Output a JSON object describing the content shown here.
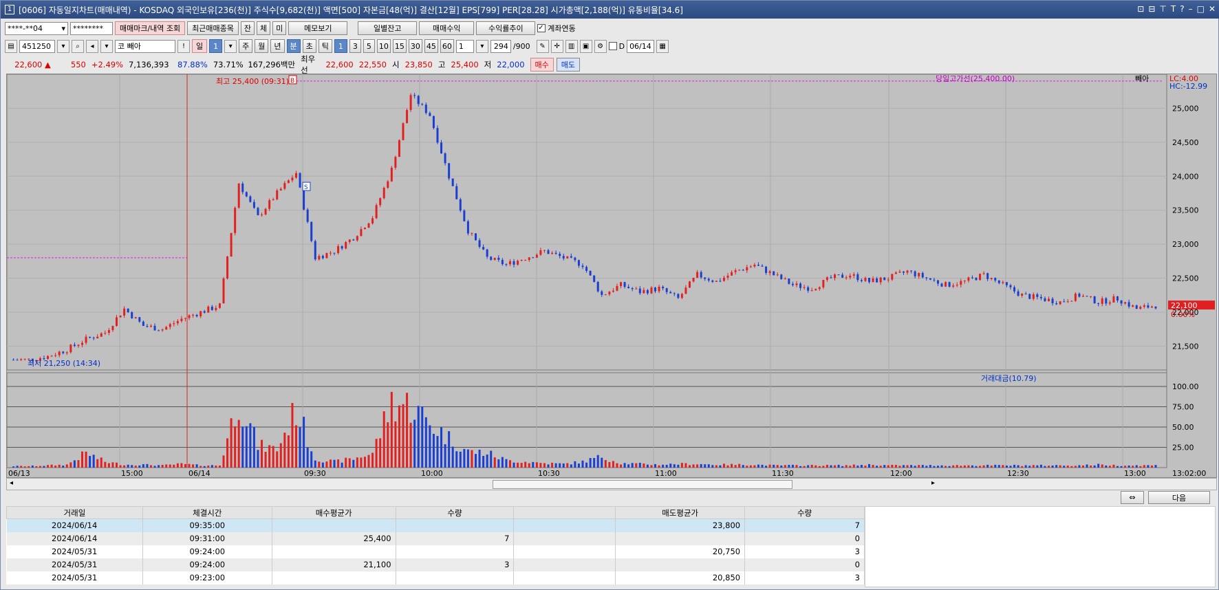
{
  "title": {
    "num": "1",
    "text": "[0606] 자동일지차트(매매내역) - KOSDAQ 외국인보유[236(천)] 주식수[9,682(천)] 액면[500] 자본금[48(억)] 결산[12월] EPS[799] PER[28.28] 시가총액[2,188(억)] 유통비율[34.6]"
  },
  "toolbar1": {
    "account": "****-**04",
    "password": "********",
    "trade_mark_btn": "매매마크/내역 조회",
    "recent_btn": "최근매매종목",
    "tab_jan": "잔",
    "tab_che": "체",
    "tab_mi": "미",
    "memo_btn": "메모보기",
    "daily_btn": "일별잔고",
    "profit_btn": "매매수익",
    "rate_btn": "수익률추이",
    "link_label": "계좌연동"
  },
  "toolbar2": {
    "code": "451250",
    "name": "코 빼아",
    "period_day": "일",
    "period_num": "1",
    "p_week": "주",
    "p_month": "월",
    "p_year": "년",
    "p_min": "분",
    "p_sec": "초",
    "p_tick": "틱",
    "intervals": [
      "1",
      "3",
      "5",
      "10",
      "15",
      "30",
      "45",
      "60"
    ],
    "count_sel": "1",
    "count": "294",
    "count_max": "/900",
    "date_label": "D",
    "date": "06/14"
  },
  "quote": {
    "price": "22,600 ▲",
    "change": "550",
    "pct": "+2.49%",
    "volume": "7,136,393",
    "vol_ratio": "87.88%",
    "turnover": "73.71%",
    "amount": "167,296백만",
    "best_label": "최우선",
    "bid1": "22,600",
    "bid2": "22,550",
    "open_label": "시",
    "open": "23,850",
    "high_label": "고",
    "high": "25,400",
    "low_label": "저",
    "low": "22,000",
    "buy_btn": "매수",
    "sell_btn": "매도"
  },
  "chart_data": {
    "type": "candlestick",
    "series_name": "빼아",
    "legend_high_line": "당일고가선(25,400.00)",
    "lc": "LC:4.00",
    "hc": "HC:-12.99",
    "high_marker": "최고 25,400 (09:31)",
    "low_marker": "최저 21,250 (14:34)",
    "buy_marker": "B",
    "sell_marker": "S",
    "current_price": "22,100",
    "current_pct": "0.00%",
    "ylim": [
      21150,
      25500
    ],
    "yticks": [
      "25,000",
      "24,500",
      "24,000",
      "23,500",
      "23,000",
      "22,500",
      "22,000",
      "21,500"
    ],
    "prev_high_line": 22800,
    "day_high_line": 25400,
    "volume_legend": "거래대금(10.79)",
    "volume_ticks": [
      "100.00",
      "75.00",
      "50.00",
      "25.00"
    ],
    "x_labels": [
      "06/13",
      "15:00",
      "06/14",
      "09:30",
      "10:00",
      "10:30",
      "11:00",
      "11:30",
      "12:00",
      "12:30",
      "13:00",
      "13:02:00"
    ],
    "price_path": [
      21300,
      21300,
      21350,
      21450,
      21600,
      21700,
      22050,
      21800,
      21750,
      21900,
      22000,
      22100,
      23900,
      23400,
      23750,
      24050,
      22800,
      22900,
      23100,
      23400,
      24100,
      25200,
      24900,
      24000,
      23200,
      22800,
      22700,
      22800,
      22900,
      22800,
      22700,
      22250,
      22400,
      22300,
      22350,
      22200,
      22550,
      22450,
      22600,
      22700,
      22550,
      22400,
      22350,
      22500,
      22550,
      22450,
      22500,
      22600,
      22500,
      22400,
      22450,
      22550,
      22400,
      22250,
      22200,
      22150,
      22250,
      22150,
      22200,
      22050,
      22100
    ],
    "volume_path": [
      2,
      2,
      3,
      4,
      20,
      8,
      4,
      4,
      3,
      5,
      3,
      3,
      95,
      30,
      25,
      80,
      12,
      8,
      12,
      20,
      90,
      85,
      60,
      40,
      22,
      20,
      10,
      8,
      6,
      5,
      8,
      15,
      6,
      5,
      4,
      5,
      5,
      4,
      4,
      4,
      3,
      3,
      3,
      3,
      3,
      4,
      3,
      3,
      3,
      3,
      3,
      3,
      3,
      3,
      3,
      3,
      3,
      4,
      3,
      3,
      3
    ]
  },
  "table": {
    "headers": [
      "거래일",
      "체결시간",
      "매수평균가",
      "수량",
      "",
      "매도평균가",
      "수량"
    ],
    "rows": [
      [
        "2024/06/14",
        "09:35:00",
        "",
        "",
        "",
        "23,800",
        "7"
      ],
      [
        "2024/06/14",
        "09:31:00",
        "25,400",
        "7",
        "",
        "",
        "0"
      ],
      [
        "2024/05/31",
        "09:24:00",
        "",
        "",
        "",
        "20,750",
        "3"
      ],
      [
        "2024/05/31",
        "09:24:00",
        "21,100",
        "3",
        "",
        "",
        "0"
      ],
      [
        "2024/05/31",
        "09:23:00",
        "",
        "",
        "",
        "20,850",
        "3"
      ]
    ]
  },
  "next_btn": "다음",
  "colors": {
    "up": "#e32020",
    "down": "#1a3fd0",
    "grid": "#9e9e9e",
    "chart_bg": "#c0c0c0"
  }
}
